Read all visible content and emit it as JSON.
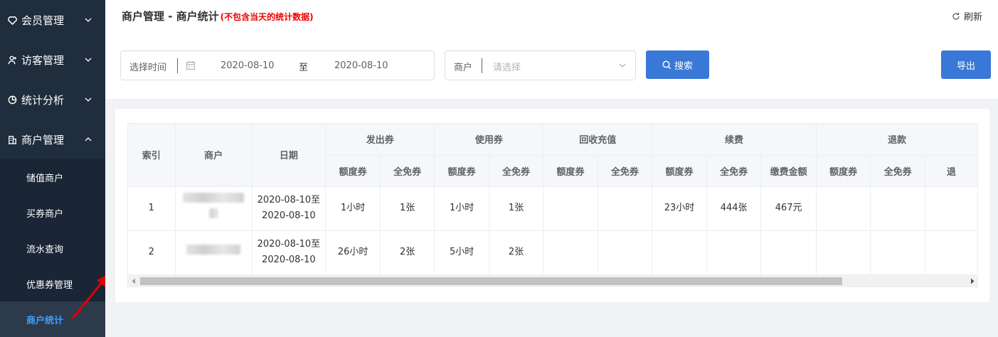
{
  "sidebar": {
    "menus": [
      {
        "label": "会员管理",
        "icon": "diamond-icon",
        "expanded": false
      },
      {
        "label": "访客管理",
        "icon": "visitor-icon",
        "expanded": false
      },
      {
        "label": "统计分析",
        "icon": "pie-chart-icon",
        "expanded": false
      },
      {
        "label": "商户管理",
        "icon": "building-icon",
        "expanded": true
      }
    ],
    "submenu": [
      "储值商户",
      "买券商户",
      "流水查询",
      "优惠券管理",
      "商户统计"
    ],
    "active_submenu": "商户统计"
  },
  "header": {
    "title": "商户管理 - 商户统计",
    "note": "(不包含当天的统计数据)",
    "refresh_label": "刷新"
  },
  "filters": {
    "date_label": "选择时间",
    "start_date": "2020-08-10",
    "range_sep": "至",
    "end_date": "2020-08-10",
    "merchant_label": "商户",
    "merchant_placeholder": "请选择",
    "search_label": "搜索",
    "export_label": "导出"
  },
  "table": {
    "fixed_headers": [
      "索引",
      "商户",
      "日期"
    ],
    "groups": [
      {
        "label": "发出券",
        "sub": [
          "额度券",
          "全免券"
        ]
      },
      {
        "label": "使用券",
        "sub": [
          "额度券",
          "全免券"
        ]
      },
      {
        "label": "回收充值",
        "sub": [
          "额度券",
          "全免券"
        ]
      },
      {
        "label": "续费",
        "sub": [
          "额度券",
          "全免券",
          "缴费金额"
        ]
      },
      {
        "label": "退款",
        "sub": [
          "额度券",
          "全免券",
          "退"
        ]
      }
    ],
    "rows": [
      {
        "index": "1",
        "date": "2020-08-10至2020-08-10",
        "cells": [
          "1小时",
          "1张",
          "1小时",
          "1张",
          "",
          "",
          "23小时",
          "444张",
          "467元",
          "",
          "",
          ""
        ]
      },
      {
        "index": "2",
        "date": "2020-08-10至2020-08-10",
        "cells": [
          "26小时",
          "2张",
          "5小时",
          "2张",
          "",
          "",
          "",
          "",
          "",
          "",
          "",
          ""
        ]
      }
    ]
  },
  "colors": {
    "sidebar_bg": "#1f2d3d",
    "primary": "#3a78d8",
    "active_text": "#409eff",
    "note_red": "#e00000"
  }
}
